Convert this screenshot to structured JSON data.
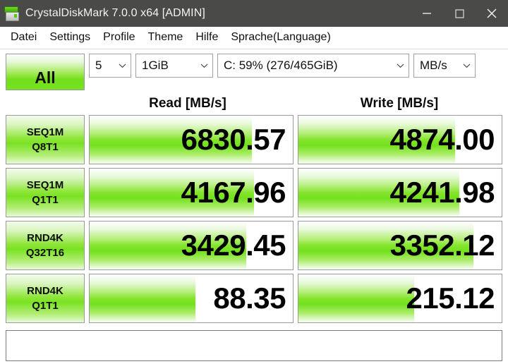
{
  "window": {
    "title": "CrystalDiskMark 7.0.0 x64 [ADMIN]",
    "icon": "disk-drive-icon",
    "titlebar_color": "#4a4a48",
    "controls": {
      "minimize": "minimize-icon",
      "maximize": "maximize-icon",
      "close": "close-icon"
    }
  },
  "menu": {
    "items": [
      {
        "label": "Datei"
      },
      {
        "label": "Settings"
      },
      {
        "label": "Profile"
      },
      {
        "label": "Theme"
      },
      {
        "label": "Hilfe"
      },
      {
        "label": "Sprache(Language)"
      }
    ]
  },
  "toolbar": {
    "all_button_label": "All",
    "accent_color": "#73e11c",
    "run_count": "5",
    "test_size": "1GiB",
    "target_drive": "C: 59% (276/465GiB)",
    "unit": "MB/s"
  },
  "headers": {
    "read": "Read [MB/s]",
    "write": "Write [MB/s]"
  },
  "results": {
    "rows": [
      {
        "test_main": "SEQ1M",
        "test_sub": "Q8T1",
        "read": "6830.57",
        "write": "4874.00",
        "read_fill_pct": 80,
        "write_fill_pct": 77
      },
      {
        "test_main": "SEQ1M",
        "test_sub": "Q1T1",
        "read": "4167.96",
        "write": "4241.98",
        "read_fill_pct": 81,
        "write_fill_pct": 79
      },
      {
        "test_main": "RND4K",
        "test_sub": "Q32T16",
        "read": "3429.45",
        "write": "3352.12",
        "read_fill_pct": 77,
        "write_fill_pct": 86
      },
      {
        "test_main": "RND4K",
        "test_sub": "Q1T1",
        "read": "88.35",
        "write": "215.12",
        "read_fill_pct": 52,
        "write_fill_pct": 57
      }
    ]
  },
  "comment": {
    "value": "",
    "placeholder": ""
  }
}
